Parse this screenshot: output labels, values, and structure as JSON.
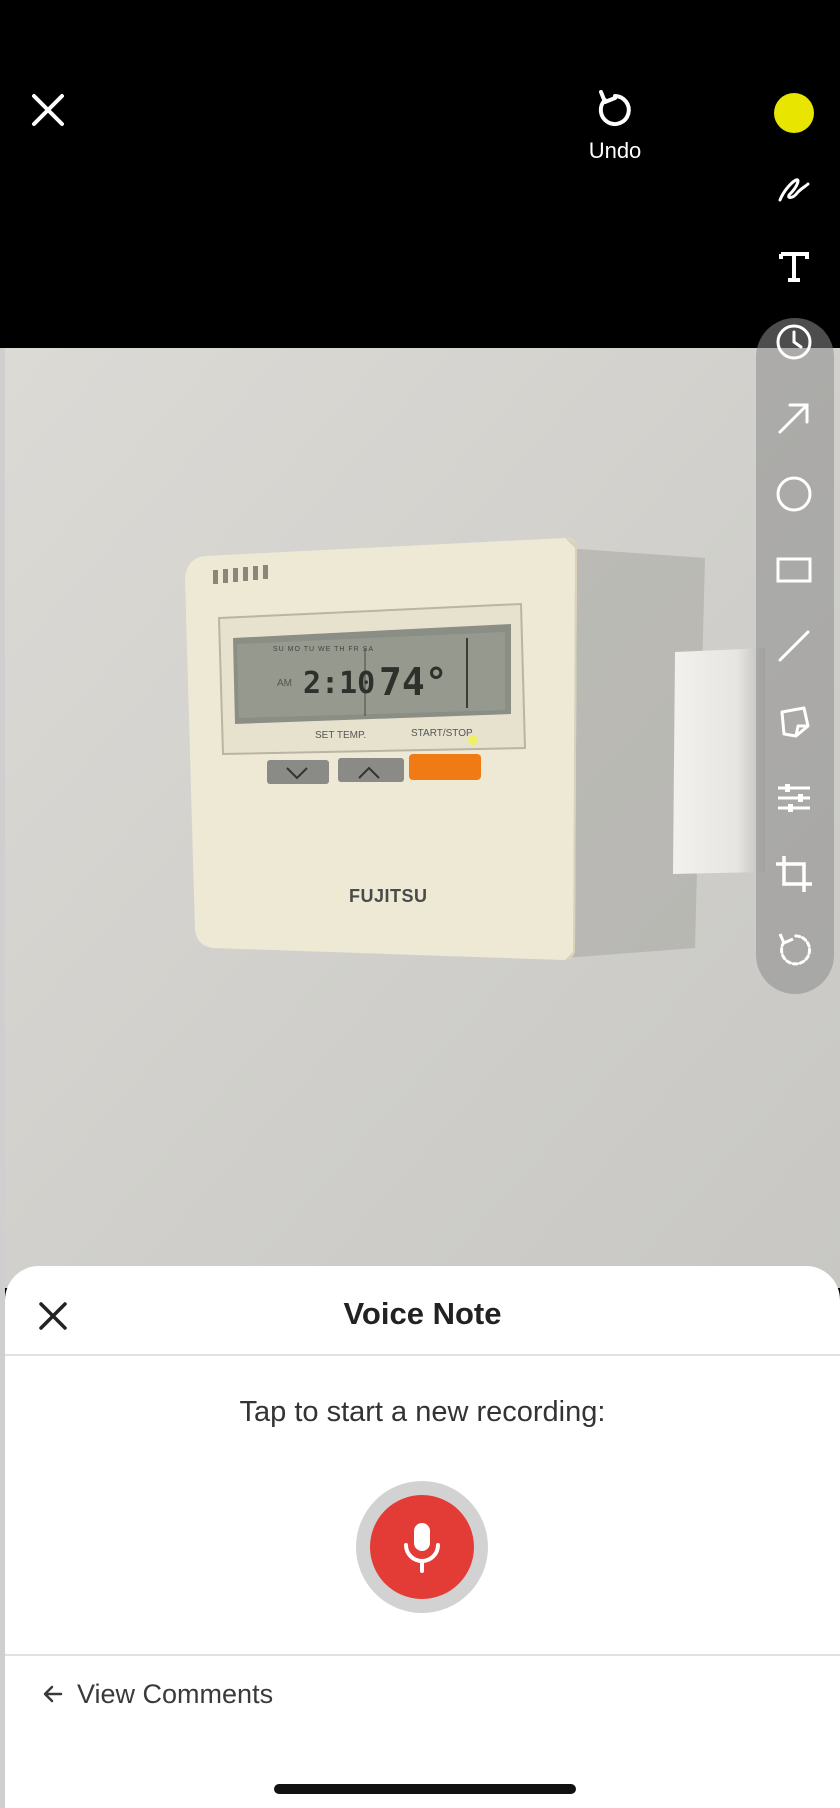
{
  "topbar": {
    "close_icon": "close-icon",
    "undo_label": "Undo",
    "color_swatch": "#e8e600"
  },
  "photo": {
    "brand": "FUJITSU",
    "display_time": "2:10",
    "display_temp": "74°",
    "set_temp_label": "SET TEMP.",
    "start_stop_label": "START/STOP",
    "days_label": "SU MO TU WE TH FR SA",
    "am_label": "AM"
  },
  "toolbar": {
    "tools": [
      "freehand-draw-icon",
      "text-icon",
      "clock-icon",
      "arrow-icon",
      "circle-icon",
      "rectangle-icon",
      "line-icon",
      "sticky-note-icon",
      "adjust-sliders-icon",
      "crop-icon",
      "rotate-icon"
    ]
  },
  "voice_note": {
    "title": "Voice Note",
    "prompt": "Tap to start a new recording:",
    "view_comments": "View Comments",
    "mic_color": "#e33b35"
  }
}
